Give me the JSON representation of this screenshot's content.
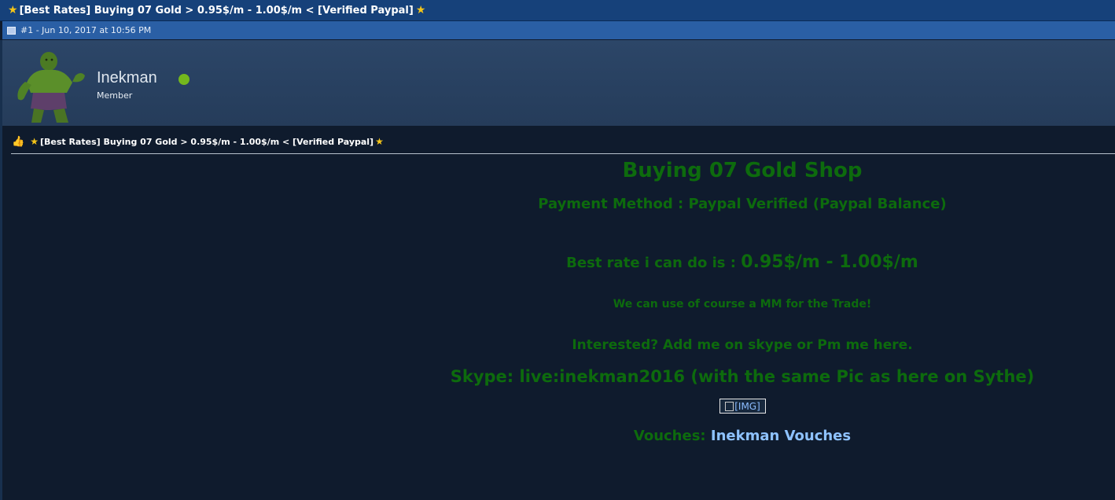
{
  "thread": {
    "title": "[Best Rates] Buying 07 Gold > 0.95$/m - 1.00$/m < [Verified Paypal]",
    "title_star_icon": "star-icon"
  },
  "post": {
    "meta": "#1 - Jun 10, 2017 at 10:56 PM",
    "icon": "post-icon"
  },
  "user": {
    "name": "Inekman",
    "title": "Member",
    "status_icon": "online-dot-icon",
    "status_color": "#74b81d"
  },
  "message": {
    "subject": "[Best Rates] Buying 07 Gold > 0.95$/m - 1.00$/m < [Verified Paypal]",
    "subject_icon": "thumbs-up-icon",
    "heading": "Buying 07 Gold Shop",
    "payment": "Payment Method : Paypal Verified (Paypal Balance)",
    "rate_prefix": "Best rate i can do is :",
    "rate_value": "0.95$/m - 1.00$/m",
    "mm_note": "We can use of course a MM for the Trade!",
    "interested": "Interested? Add me on skype or Pm me here.",
    "skype": "Skype: live:inekman2016 (with the same Pic as here on Sythe)",
    "image_placeholder": "[IMG]",
    "vouches_label": "Vouches:",
    "vouches_link": "Inekman Vouches"
  },
  "colors": {
    "content_text": "#0d6b0d",
    "link": "#8ec2ff",
    "background": "#0f1b2d",
    "title_bar": "#16417a",
    "post_bar": "#2a5fa5"
  }
}
